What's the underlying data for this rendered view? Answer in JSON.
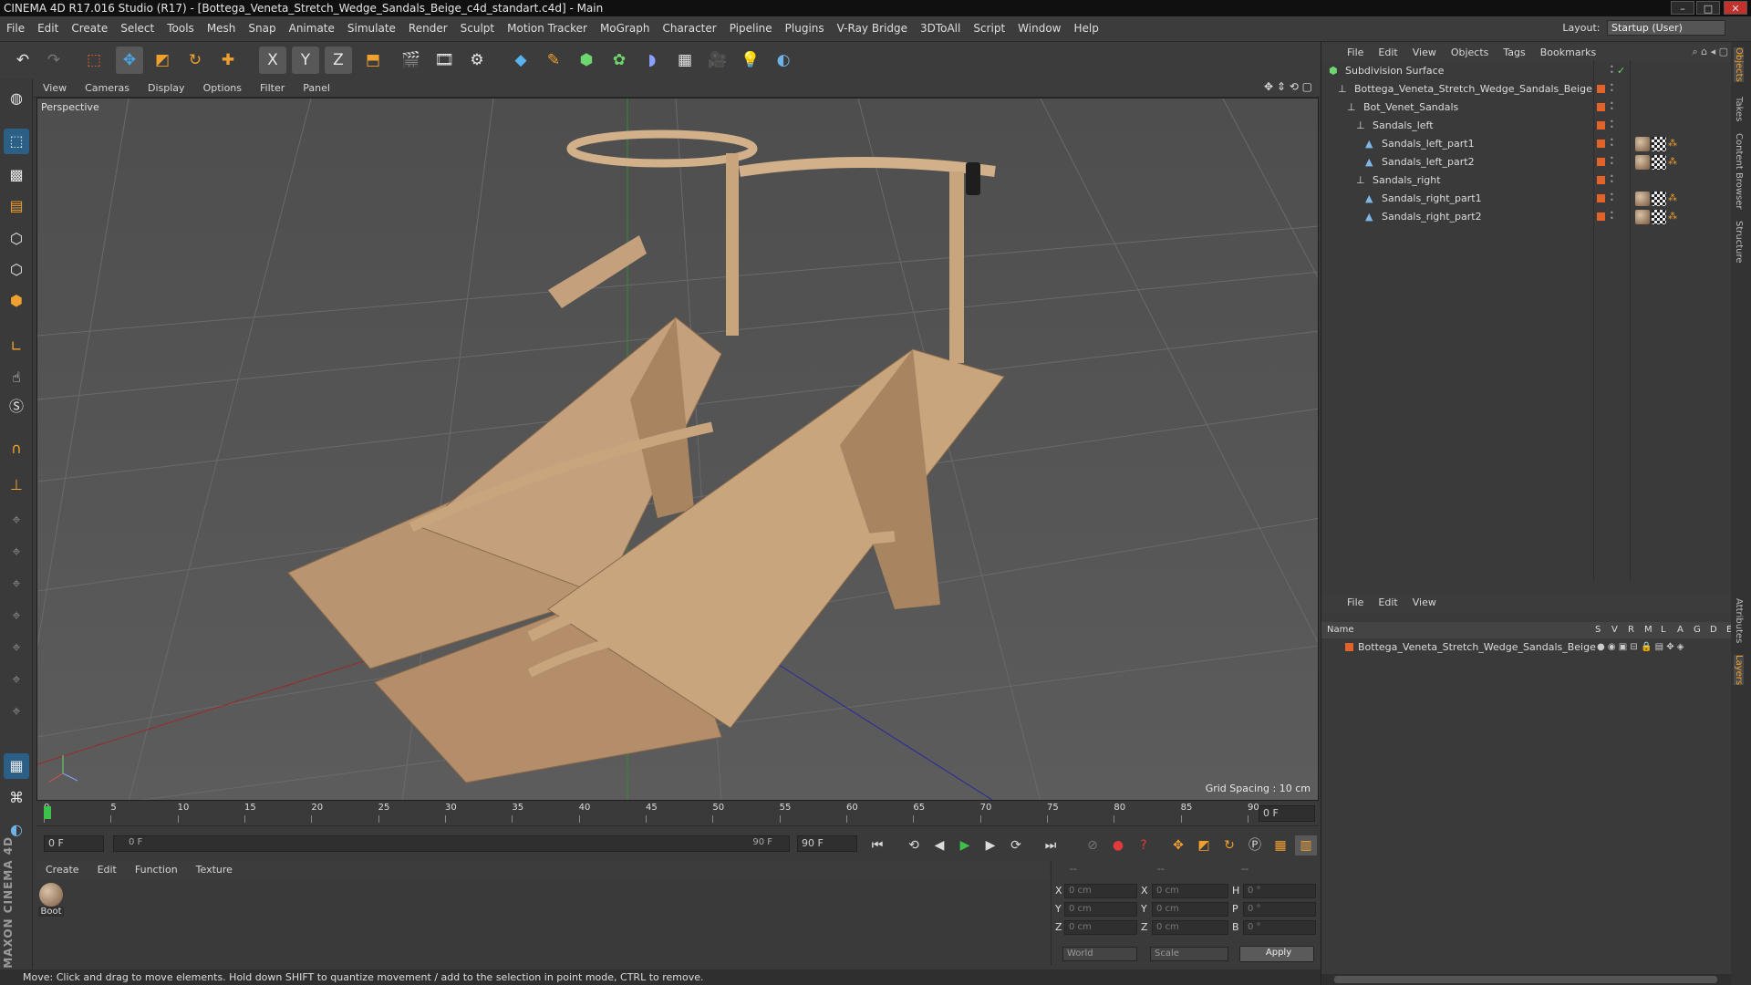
{
  "app": {
    "title": "CINEMA 4D R17.016 Studio (R17) - [Bottega_Veneta_Stretch_Wedge_Sandals_Beige_c4d_standart.c4d] - Main",
    "window_controls": [
      "–",
      "□",
      "✕"
    ]
  },
  "menubar": {
    "items": [
      "File",
      "Edit",
      "Create",
      "Select",
      "Tools",
      "Mesh",
      "Snap",
      "Animate",
      "Simulate",
      "Render",
      "Sculpt",
      "Motion Tracker",
      "MoGraph",
      "Character",
      "Pipeline",
      "Plugins",
      "V-Ray Bridge",
      "3DToAll",
      "Script",
      "Window",
      "Help"
    ],
    "layout_label": "Layout:",
    "layout_value": "Startup (User)"
  },
  "toolbar": {
    "icons": [
      "undo-icon",
      "redo-icon",
      "live-selection-icon",
      "move-icon",
      "scale-icon",
      "rotate-icon",
      "add-object-icon",
      "x-axis-icon",
      "y-axis-icon",
      "z-axis-icon",
      "world-coordinates-icon",
      "render-view-icon",
      "render-picture-viewer-icon",
      "render-settings-icon",
      "cube-icon",
      "pen-spline-icon",
      "subdivision-icon",
      "array-icon",
      "deformer-icon",
      "floor-icon",
      "camera-icon",
      "light-icon",
      "python-icon"
    ],
    "axis_labels": [
      "X",
      "Y",
      "Z"
    ]
  },
  "viewport": {
    "menu": [
      "View",
      "Cameras",
      "Display",
      "Options",
      "Filter",
      "Panel"
    ],
    "label": "Perspective",
    "grid_spacing": "Grid Spacing : 10 cm"
  },
  "timeline": {
    "ticks": [
      "0",
      "5",
      "10",
      "15",
      "20",
      "25",
      "30",
      "35",
      "40",
      "45",
      "50",
      "55",
      "60",
      "65",
      "70",
      "75",
      "80",
      "85",
      "90"
    ],
    "current_frame": "0 F"
  },
  "transport": {
    "start_field": "0 F",
    "range_start": "0 F",
    "range_end": "90 F",
    "end_field": "90 F"
  },
  "materials": {
    "menu": [
      "Create",
      "Edit",
      "Function",
      "Texture"
    ],
    "items": [
      {
        "name": "Boot"
      }
    ]
  },
  "coordinates": {
    "header": [
      "--",
      "--",
      "--"
    ],
    "rows": [
      {
        "a": "X",
        "v1": "0 cm",
        "b": "X",
        "v2": "0 cm",
        "c": "H",
        "v3": "0 °"
      },
      {
        "a": "Y",
        "v1": "0 cm",
        "b": "Y",
        "v2": "0 cm",
        "c": "P",
        "v3": "0 °"
      },
      {
        "a": "Z",
        "v1": "0 cm",
        "b": "Z",
        "v2": "0 cm",
        "c": "B",
        "v3": "0 °"
      }
    ],
    "mode_world": "World",
    "mode_scale": "Scale",
    "apply": "Apply"
  },
  "status": {
    "text": "Move: Click and drag to move elements. Hold down SHIFT to quantize movement / add to the selection in point mode, CTRL to remove."
  },
  "object_manager": {
    "menu": [
      "File",
      "Edit",
      "View",
      "Objects",
      "Tags",
      "Bookmarks"
    ],
    "objects": [
      {
        "name": "Subdivision Surface",
        "depth": 0,
        "icon": "subdivision-icon"
      },
      {
        "name": "Bottega_Veneta_Stretch_Wedge_Sandals_Beige",
        "depth": 1,
        "icon": "null-icon"
      },
      {
        "name": "Bot_Venet_Sandals",
        "depth": 2,
        "icon": "null-icon"
      },
      {
        "name": "Sandals_left",
        "depth": 3,
        "icon": "null-icon"
      },
      {
        "name": "Sandals_left_part1",
        "depth": 4,
        "icon": "polygon-icon"
      },
      {
        "name": "Sandals_left_part2",
        "depth": 4,
        "icon": "polygon-icon"
      },
      {
        "name": "Sandals_right",
        "depth": 3,
        "icon": "null-icon"
      },
      {
        "name": "Sandals_right_part1",
        "depth": 4,
        "icon": "polygon-icon"
      },
      {
        "name": "Sandals_right_part2",
        "depth": 4,
        "icon": "polygon-icon"
      }
    ]
  },
  "layer_manager": {
    "menu": [
      "File",
      "Edit",
      "View"
    ],
    "header_name": "Name",
    "header_cols": [
      "S",
      "V",
      "R",
      "M",
      "L",
      "A",
      "G",
      "D",
      "E"
    ],
    "layers": [
      {
        "name": "Bottega_Veneta_Stretch_Wedge_Sandals_Beige"
      }
    ]
  },
  "side_tabs": [
    "Objects",
    "Takes",
    "Content Browser",
    "Structure",
    "Attributes",
    "Layers"
  ],
  "colors": {
    "accent_orange": "#e2632a",
    "selection_blue": "#2b5f86",
    "sandal_beige": "#c9a57e"
  },
  "logo": "MAXON CINEMA 4D"
}
